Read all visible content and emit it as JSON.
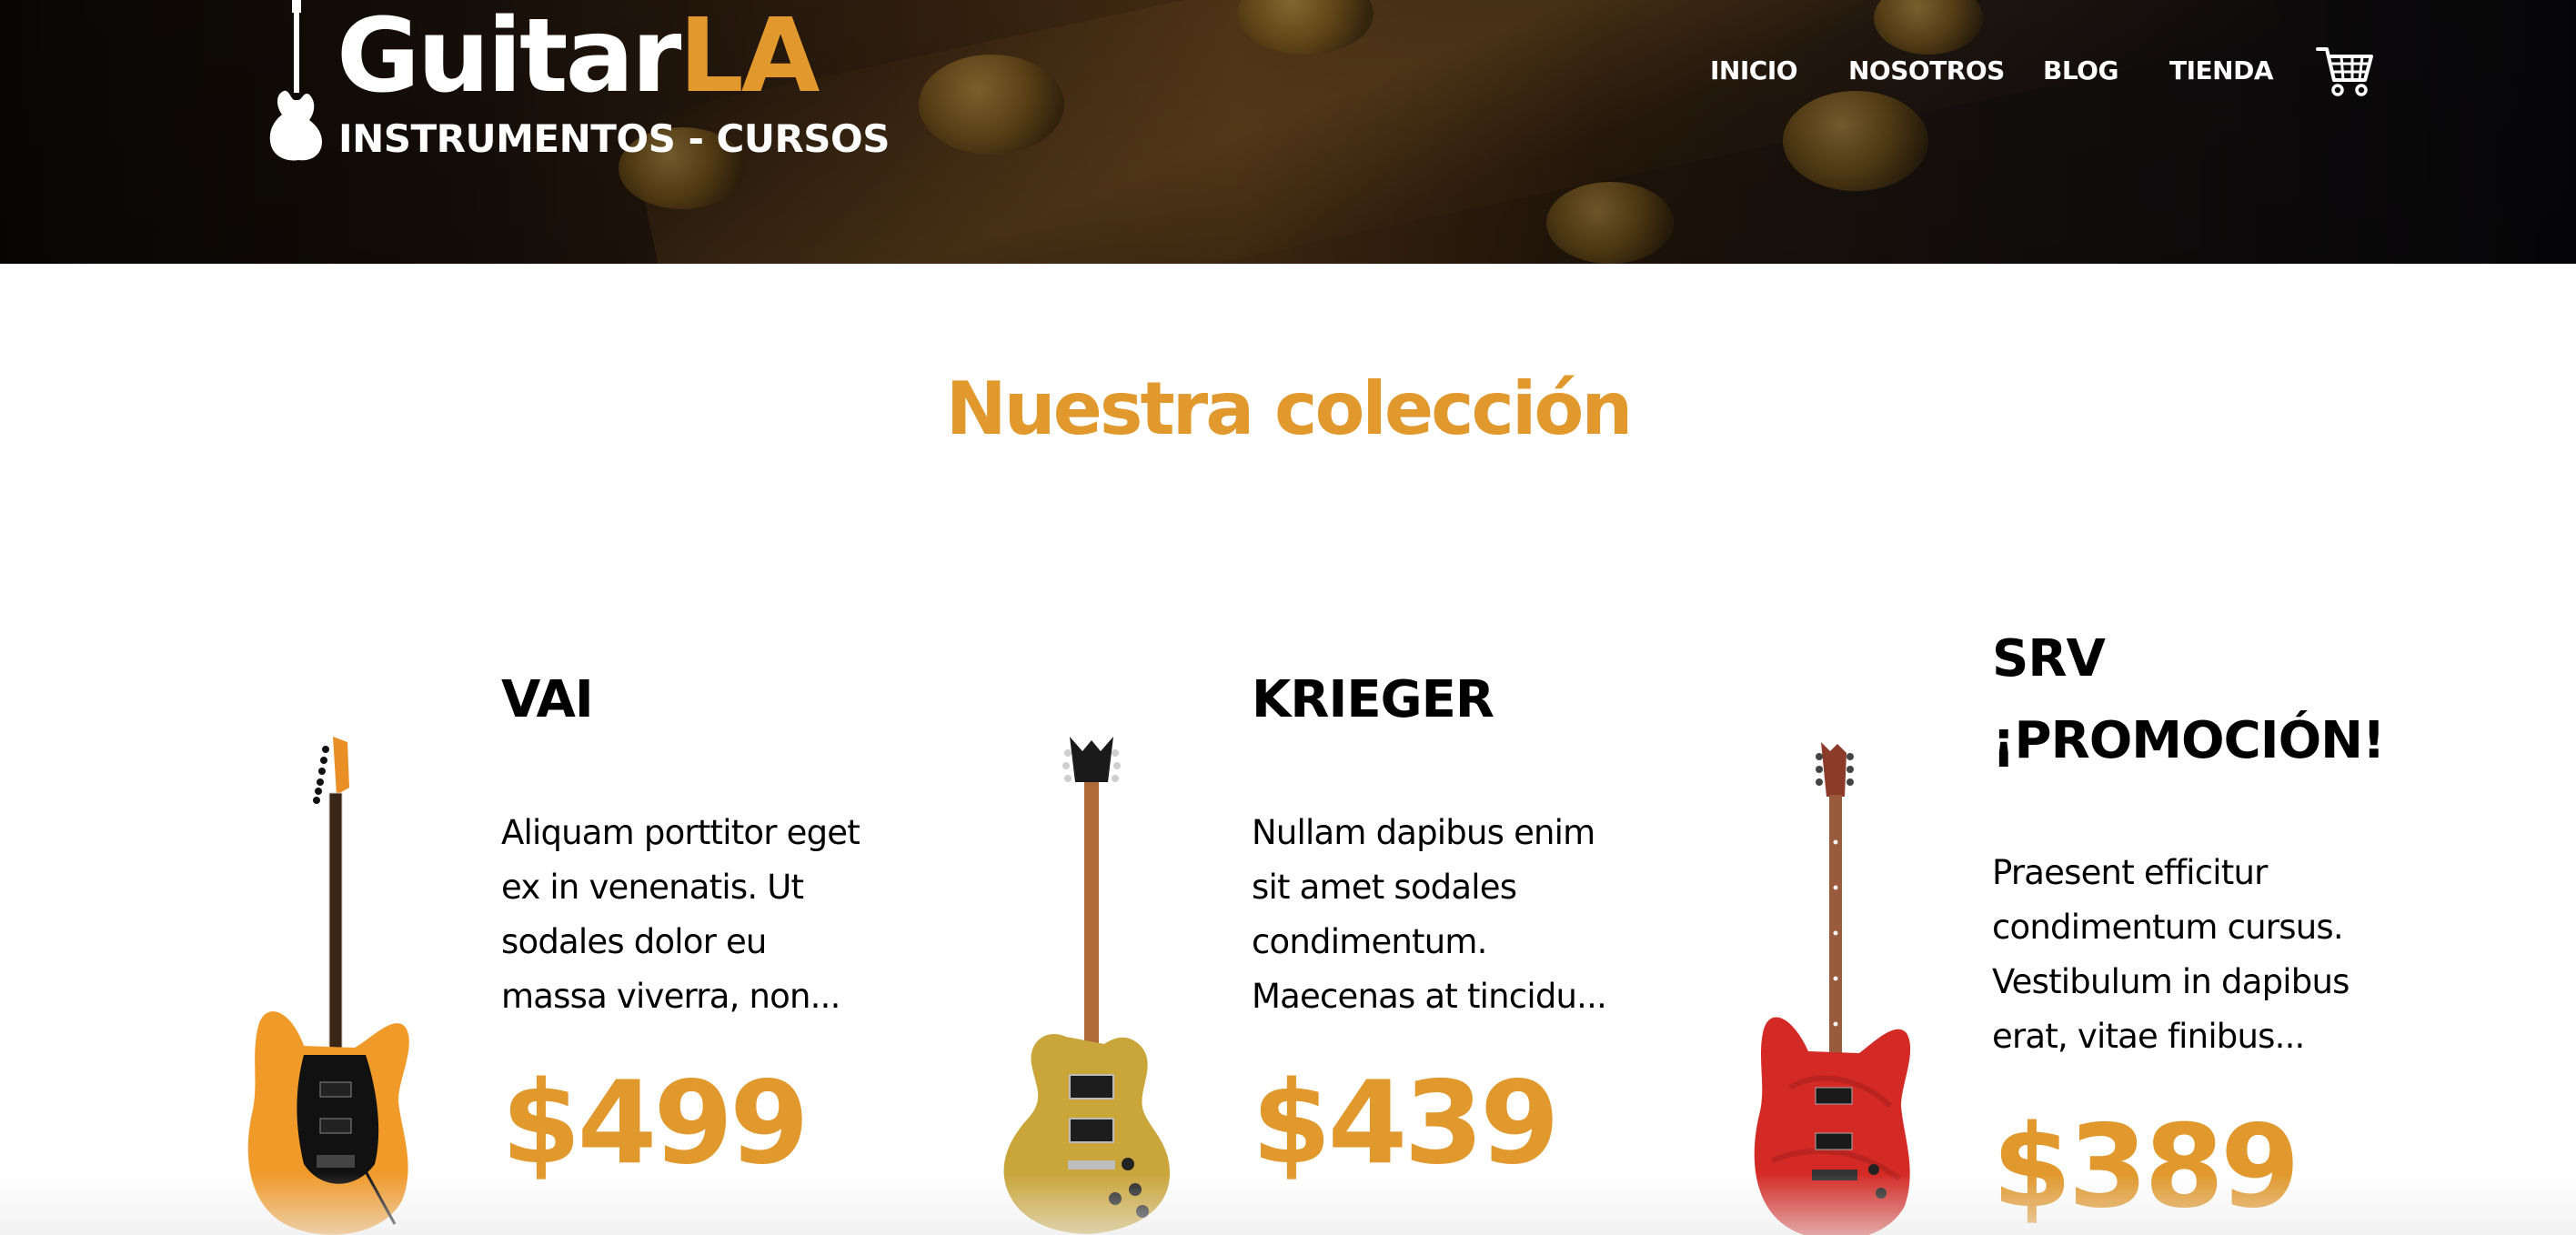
{
  "header": {
    "logo": {
      "word_part1": "Guitar",
      "word_part2": "LA",
      "subtitle": "INSTRUMENTOS - CURSOS"
    },
    "nav": {
      "items": [
        "INICIO",
        "NOSOTROS",
        "BLOG",
        "TIENDA"
      ]
    },
    "cart_icon": "shopping-cart-icon"
  },
  "main": {
    "title": "Nuestra colección",
    "products": [
      {
        "name": "VAI",
        "description_lines": [
          "Aliquam porttitor eget",
          "ex in venenatis. Ut",
          "sodales dolor eu",
          "massa viverra, non..."
        ],
        "price": "$499",
        "guitar_color": "#f0962a"
      },
      {
        "name": "KRIEGER",
        "description_lines": [
          "Nullam dapibus enim",
          "sit amet sodales",
          "condimentum.",
          "Maecenas at tincidu..."
        ],
        "price": "$439",
        "guitar_color": "#c9a53a"
      },
      {
        "name_lines": [
          "SRV",
          "¡PROMOCIÓN!"
        ],
        "description_lines": [
          "Praesent efficitur",
          "condimentum cursus.",
          "Vestibulum in dapibus",
          "erat, vitae finibus..."
        ],
        "price": "$389",
        "guitar_color": "#d42a26"
      }
    ]
  },
  "colors": {
    "accent": "#e1982c",
    "text": "#000000",
    "header_text": "#ffffff"
  }
}
